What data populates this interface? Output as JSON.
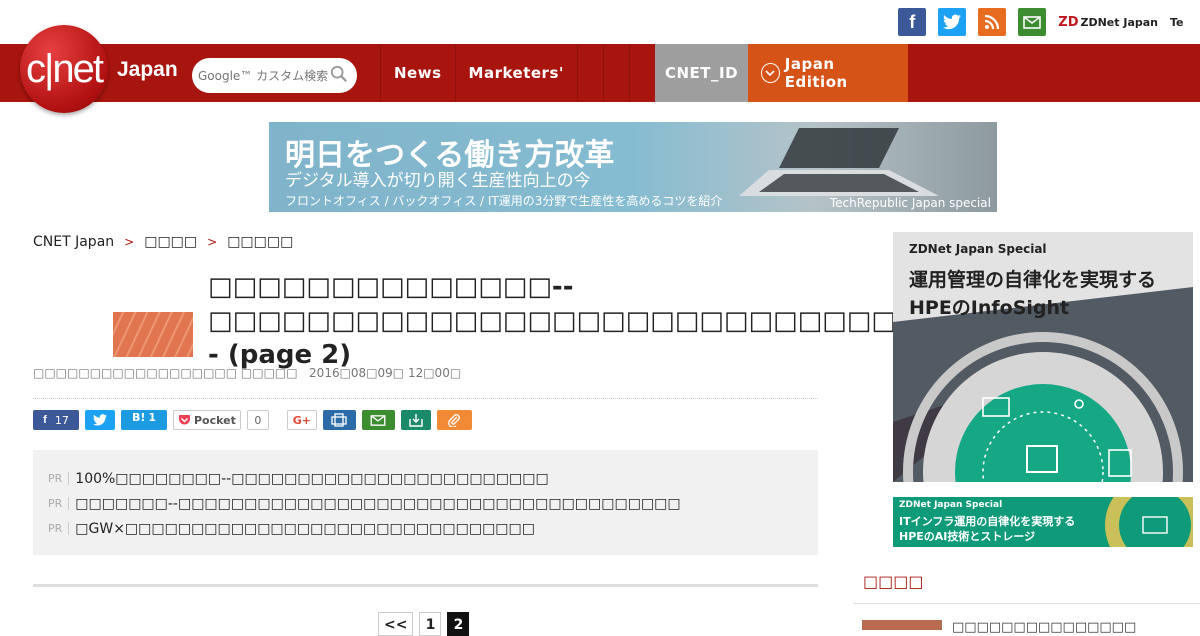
{
  "social": {
    "icons": [
      "facebook-icon",
      "twitter-icon",
      "rss-icon",
      "mail-icon"
    ],
    "zdnet_label": "ZDNet Japan",
    "zdnet_prefix": "ZD",
    "tech_label": "Te"
  },
  "header": {
    "logo_text": "c|net",
    "logo_sub": "Japan",
    "search_placeholder": "Google™ カスタム検索",
    "nav": [
      "News",
      "Marketers'"
    ],
    "cnet_id": "CNET_ID",
    "edition": "Japan Edition"
  },
  "banner": {
    "headline": "明日をつくる働き方改革",
    "sub": "デジタル導入が切り開く生産性向上の今",
    "line3": "フロントオフィス / バックオフィス / IT運用の3分野で生産性を高めるコツを紹介",
    "sponsor": "TechRepublic Japan special"
  },
  "breadcrumb": {
    "home": "CNET Japan",
    "sep": ">",
    "level1": "□□□□",
    "level2": "□□□□□"
  },
  "article": {
    "title": "□□□□□□□□□□□□□□--□□□□□□□□□□□□□□□□□□□□□□□□□□□□□ - (page 2)",
    "byline_author": "□□□□□□□□□□□□□□□□□□ □□□□□",
    "byline_date": "2016□08□09□ 12□00□"
  },
  "share": {
    "facebook_count": "17",
    "hatena_label": "B!",
    "hatena_count": "1",
    "pocket_label": "Pocket",
    "pocket_count": "0",
    "gplus_label": "G+"
  },
  "pr": {
    "tag": "PR",
    "items": [
      "100%□□□□□□□□--□□□□□□□□□□□□□□□□□□□□□□□□",
      "□□□□□□□--□□□□□□□□□□□□□□□□□□□□□□□□□□□□□□□□□□□□□□",
      "□GW×□□□□□□□□□□□□□□□□□□□□□□□□□□□□□□□"
    ]
  },
  "pager": {
    "prev": "<<",
    "pages": [
      "1",
      "2"
    ],
    "current": "2"
  },
  "side": {
    "ad1_label": "ZDNet Japan Special",
    "ad1_line1": "運用管理の自律化を実現する",
    "ad1_line2": "HPEのInfoSight",
    "ad2_label": "ZDNet Japan Special",
    "ad2_line1": "ITインフラ運用の自律化を実現する",
    "ad2_line2": "HPEのAI技術とストレージ",
    "section_title": "□□□□",
    "item_text": "□□□□□□□□□□□□□□□"
  },
  "colors": {
    "brand_red": "#a8150e",
    "edition_orange": "#d55317",
    "cnetid_gray": "#9e9e9e"
  }
}
